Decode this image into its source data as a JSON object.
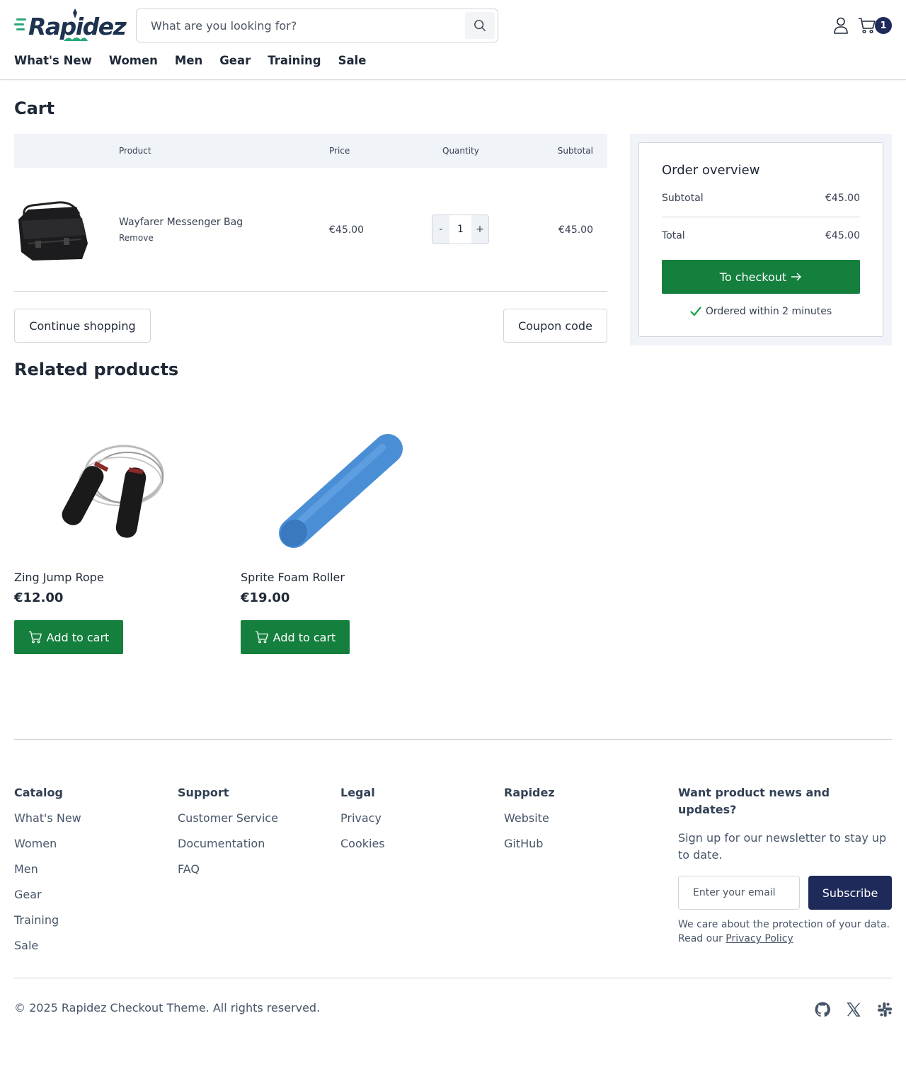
{
  "header": {
    "logo_text": "Rapidez",
    "search_placeholder": "What are you looking for?",
    "cart_count": "1",
    "nav": [
      "What's New",
      "Women",
      "Men",
      "Gear",
      "Training",
      "Sale"
    ]
  },
  "cart": {
    "title": "Cart",
    "columns": {
      "product": "Product",
      "price": "Price",
      "quantity": "Quantity",
      "subtotal": "Subtotal"
    },
    "items": [
      {
        "name": "Wayfarer Messenger Bag",
        "remove": "Remove",
        "price": "€45.00",
        "qty_minus": "-",
        "qty": "1",
        "qty_plus": "+",
        "subtotal": "€45.00"
      }
    ],
    "continue_label": "Continue shopping",
    "coupon_label": "Coupon code"
  },
  "overview": {
    "title": "Order overview",
    "subtotal_label": "Subtotal",
    "subtotal_value": "€45.00",
    "total_label": "Total",
    "total_value": "€45.00",
    "checkout_label": "To checkout",
    "ordered_note": "Ordered within 2 minutes"
  },
  "related": {
    "title": "Related products",
    "products": [
      {
        "name": "Zing Jump Rope",
        "price": "€12.00",
        "add_label": "Add to cart"
      },
      {
        "name": "Sprite Foam Roller",
        "price": "€19.00",
        "add_label": "Add to cart"
      }
    ]
  },
  "footer": {
    "catalog": {
      "title": "Catalog",
      "links": [
        "What's New",
        "Women",
        "Men",
        "Gear",
        "Training",
        "Sale"
      ]
    },
    "support": {
      "title": "Support",
      "links": [
        "Customer Service",
        "Documentation",
        "FAQ"
      ]
    },
    "legal": {
      "title": "Legal",
      "links": [
        "Privacy",
        "Cookies"
      ]
    },
    "rapidez": {
      "title": "Rapidez",
      "links": [
        "Website",
        "GitHub"
      ]
    },
    "newsletter": {
      "title": "Want product news and updates?",
      "text": "Sign up for our newsletter to stay up to date.",
      "email_placeholder": "Enter your email",
      "subscribe_label": "Subscribe",
      "privacy_text": "We care about the protection of your data. Read our",
      "privacy_link": "Privacy Policy"
    },
    "copyright": "© 2025 Rapidez Checkout Theme. All rights reserved.",
    "social_icons": [
      "github-icon",
      "x-icon",
      "slack-icon"
    ]
  },
  "colors": {
    "brand_green": "#15803d",
    "navy": "#1e2a5a",
    "panel_bg": "#f0f3f8"
  }
}
